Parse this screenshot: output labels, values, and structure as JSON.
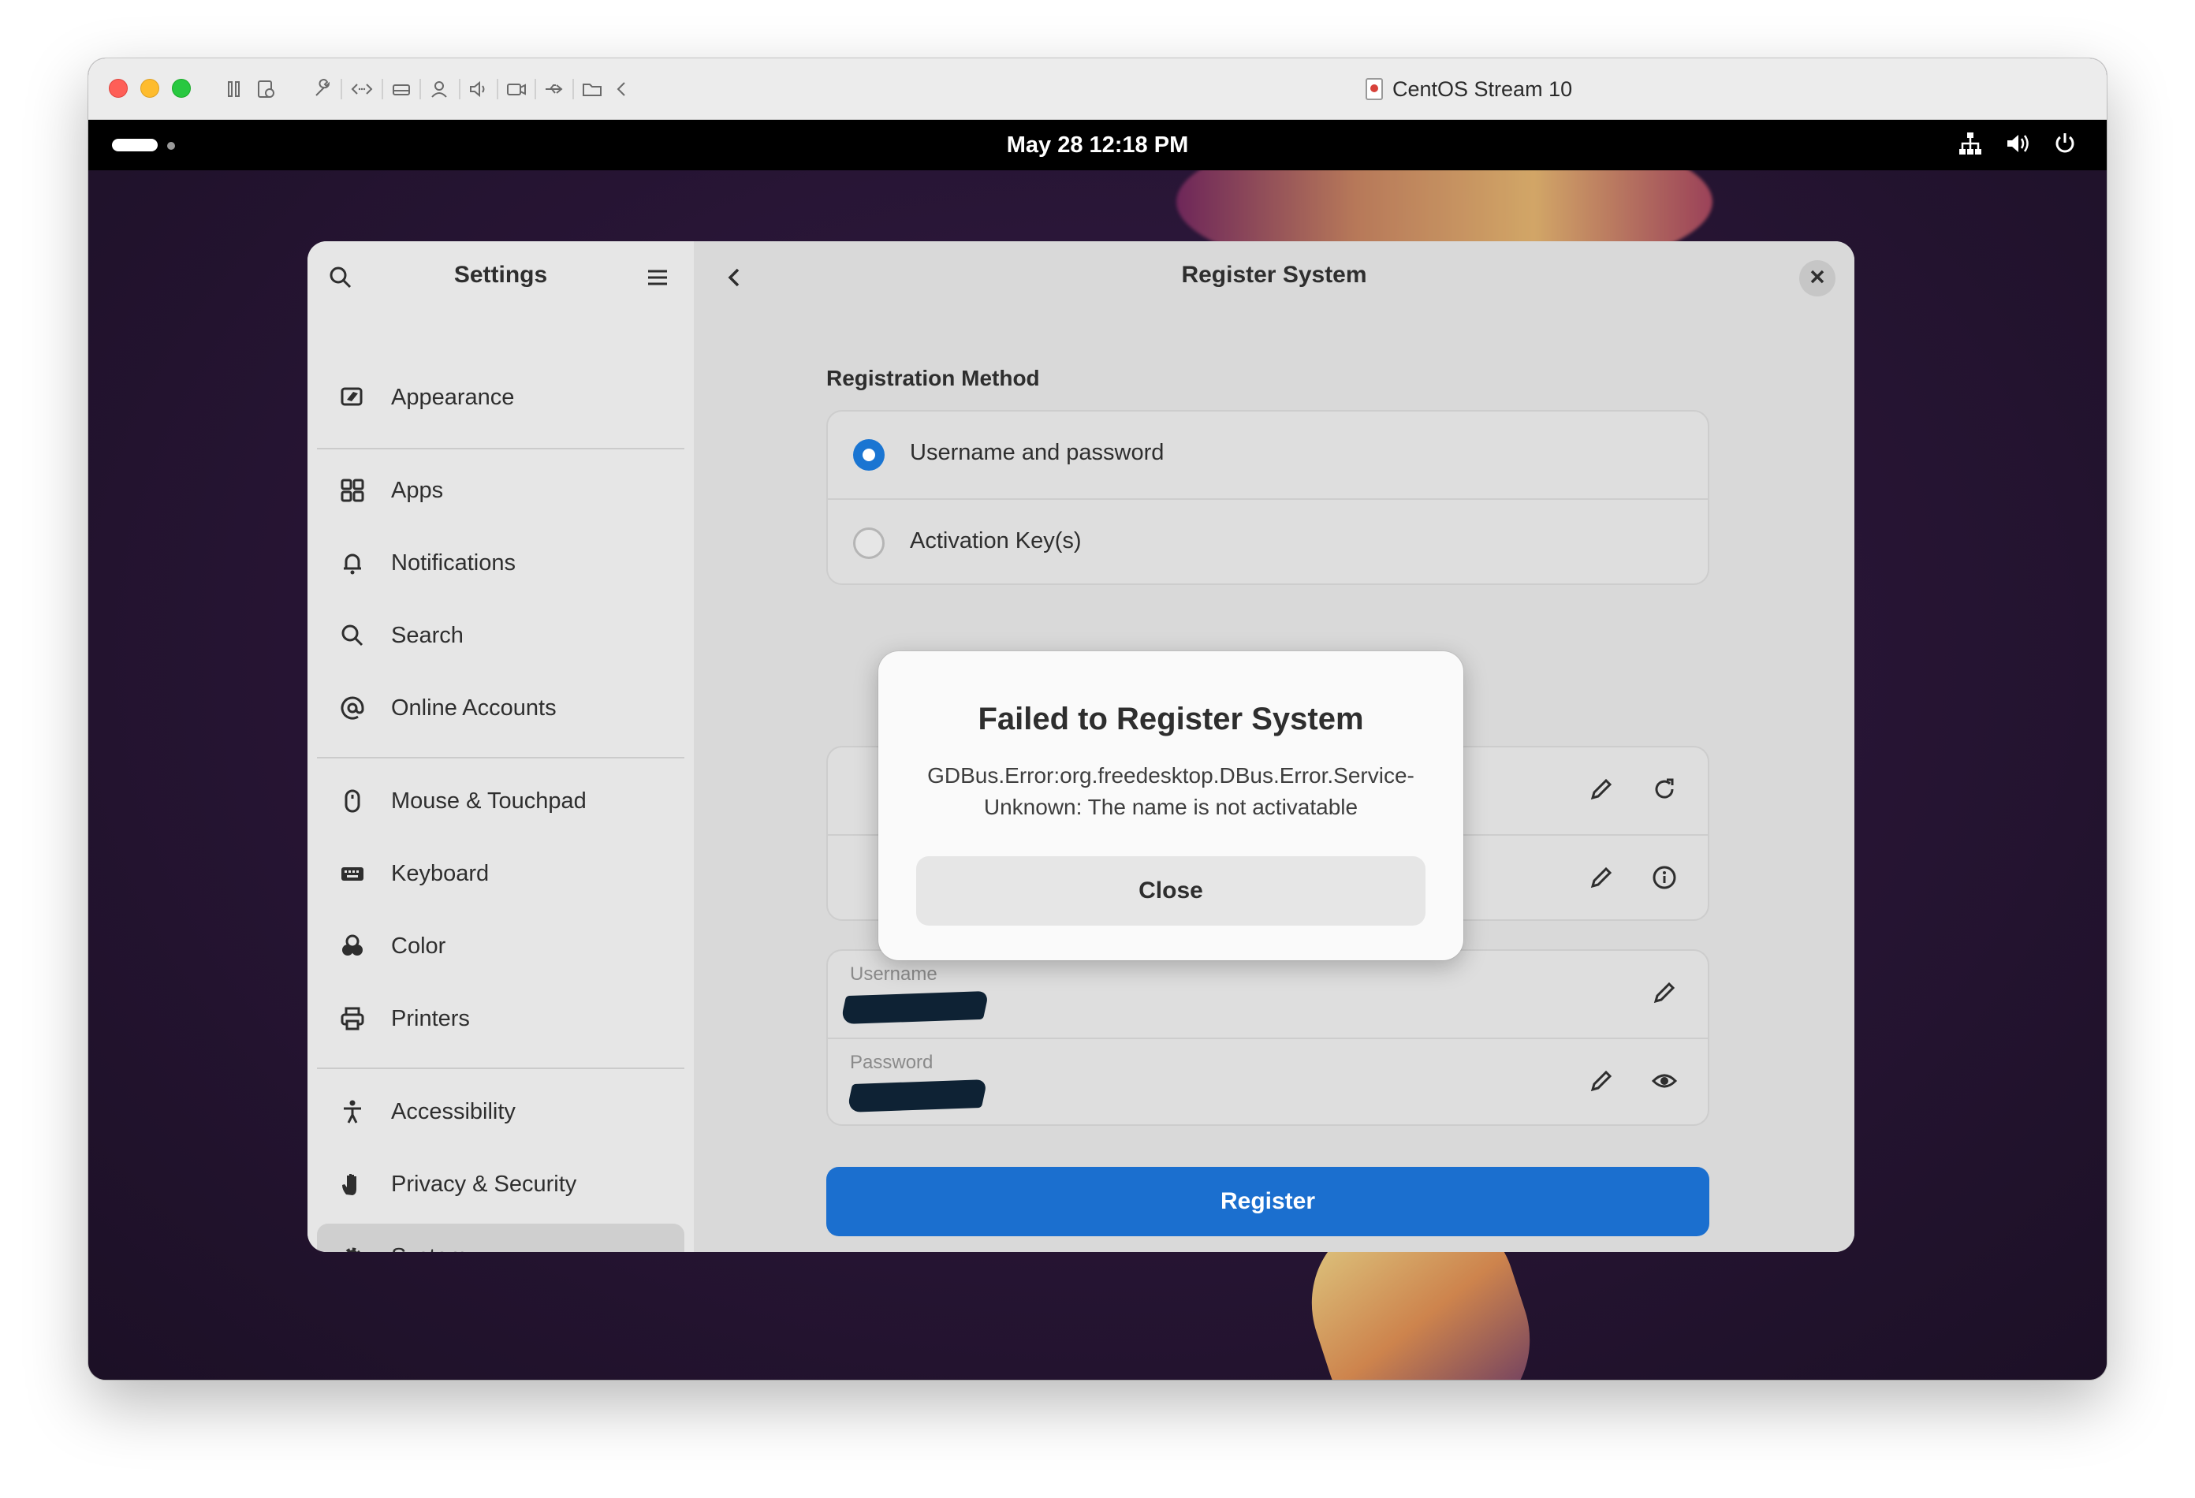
{
  "vm": {
    "title": "CentOS Stream 10"
  },
  "topbar": {
    "clock": "May 28  12:18 PM"
  },
  "settings": {
    "sidebar_title": "Settings",
    "content_title": "Register System",
    "sidebar_items": [
      {
        "label": "Appearance",
        "icon": "appearance-icon"
      },
      {
        "label": "Apps",
        "icon": "apps-grid-icon"
      },
      {
        "label": "Notifications",
        "icon": "bell-icon"
      },
      {
        "label": "Search",
        "icon": "search-icon"
      },
      {
        "label": "Online Accounts",
        "icon": "at-sign-icon"
      },
      {
        "label": "Mouse & Touchpad",
        "icon": "mouse-icon"
      },
      {
        "label": "Keyboard",
        "icon": "keyboard-icon"
      },
      {
        "label": "Color",
        "icon": "color-icon"
      },
      {
        "label": "Printers",
        "icon": "printer-icon"
      },
      {
        "label": "Accessibility",
        "icon": "accessibility-icon"
      },
      {
        "label": "Privacy & Security",
        "icon": "hand-icon"
      },
      {
        "label": "System",
        "icon": "gear-icon",
        "selected": true
      }
    ],
    "registration": {
      "section_title": "Registration Method",
      "options": [
        {
          "label": "Username and password",
          "checked": true
        },
        {
          "label": "Activation Key(s)",
          "checked": false
        }
      ]
    },
    "credentials": {
      "username_caption": "Username",
      "password_caption": "Password"
    },
    "register_label": "Register"
  },
  "dialog": {
    "title": "Failed to Register System",
    "message_line1": "GDBus.Error:org.freedesktop.DBus.Error.Service-",
    "message_line2": "Unknown: The name is not activatable",
    "close_label": "Close"
  },
  "colors": {
    "accent": "#1b6fcf",
    "traffic_red": "#fe5f57",
    "traffic_yellow": "#febc2e",
    "traffic_green": "#28c840"
  }
}
